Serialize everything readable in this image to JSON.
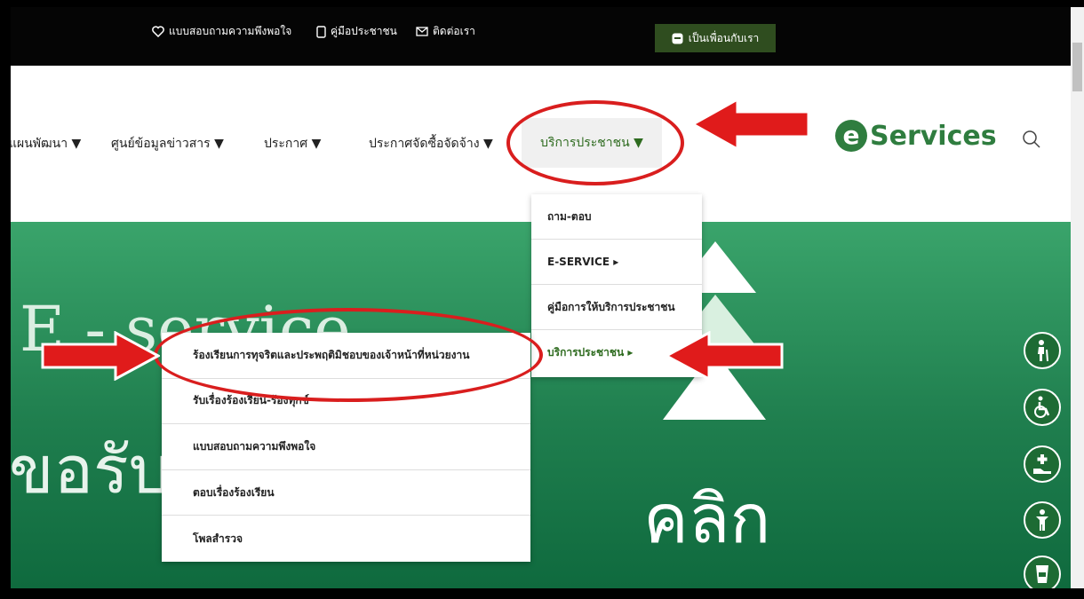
{
  "topbar": {
    "links": [
      {
        "label": "แบบสอบถามความพึงพอใจ",
        "icon": "heart-icon"
      },
      {
        "label": "คู่มือประชาชน",
        "icon": "phone-icon"
      },
      {
        "label": "ติดต่อเรา",
        "icon": "mail-icon"
      }
    ],
    "friend_button": "เป็นเพื่อนกับเรา"
  },
  "nav": {
    "items": [
      {
        "label": "แผนพัฒนา ▼"
      },
      {
        "label": "ศูนย์ข้อมูลข่าวสาร ▼"
      },
      {
        "label": "ประกาศ ▼"
      },
      {
        "label": "ประกาศจัดซื้อจัดจ้าง ▼"
      }
    ],
    "active": "บริการประชาชน ▼",
    "logo_letter": "e",
    "logo_text": "Services"
  },
  "banner": {
    "line1": "E - service",
    "line2": "ขอรับบ",
    "line3": "คลิก"
  },
  "submenu_level1": [
    {
      "label": "ถาม-ตอบ"
    },
    {
      "label": "E-SERVICE ▸"
    },
    {
      "label": "คู่มือการให้บริการประชาชน"
    },
    {
      "label": "บริการประชาชน ▸"
    }
  ],
  "submenu_level2": [
    {
      "label": "ร้องเรียนการทุจริตและประพฤติมิชอบของเจ้าหน้าที่หน่วยงาน"
    },
    {
      "label": "รับเรื่องร้องเรียน-ร้องทุกข์"
    },
    {
      "label": "แบบสอบถามความพึงพอใจ"
    },
    {
      "label": "ตอบเรื่องร้องเรียน"
    },
    {
      "label": "โพลสำรวจ"
    }
  ],
  "colors": {
    "accent_green": "#2e6b1f",
    "banner_green": "#1f7e4e",
    "annotation_red": "#d91e1e"
  }
}
